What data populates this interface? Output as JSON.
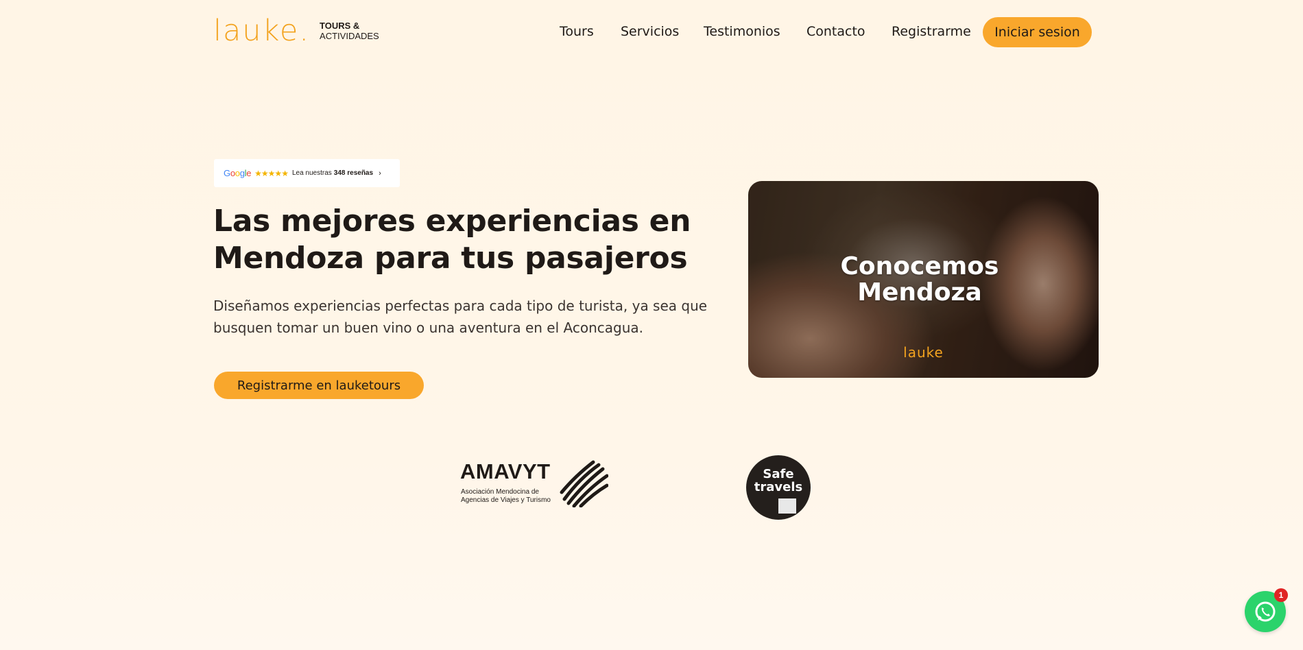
{
  "logo": {
    "brand": "lauke.",
    "tag_line1": "TOURS &",
    "tag_line2": "ACTIVIDADES"
  },
  "nav": {
    "links": [
      "Tours",
      "Servicios",
      "Testimonios",
      "Contacto",
      "Registrarme"
    ],
    "login_label": "Iniciar sesion"
  },
  "reviews": {
    "google_word": "Google",
    "stars": "★★★★★",
    "prefix": "Lea nuestras",
    "count_label": "348 reseñas",
    "chevron": "›"
  },
  "hero": {
    "title": "Las mejores experiencias en Mendoza para tus pasajeros",
    "subtitle": "Diseñamos experiencias perfectas para cada tipo de turista, ya sea que busquen tomar un buen vino o una aventura en el Aconcagua.",
    "cta_label": "Registrarme en lauketours"
  },
  "video": {
    "title_line1": "Conocemos",
    "title_line2": "Mendoza",
    "logo": "lauke"
  },
  "partners": {
    "amavyt_name": "AMAVYT",
    "amavyt_sub": "Asociación Mendocina de Agencias de Viajes y Turismo",
    "safe_line1": "Safe",
    "safe_line2": "travels"
  },
  "whatsapp": {
    "badge_count": "1"
  },
  "colors": {
    "accent": "#f9a72c",
    "background": "#fff5e6",
    "text": "#1f1a17",
    "whatsapp": "#2bd36b"
  }
}
